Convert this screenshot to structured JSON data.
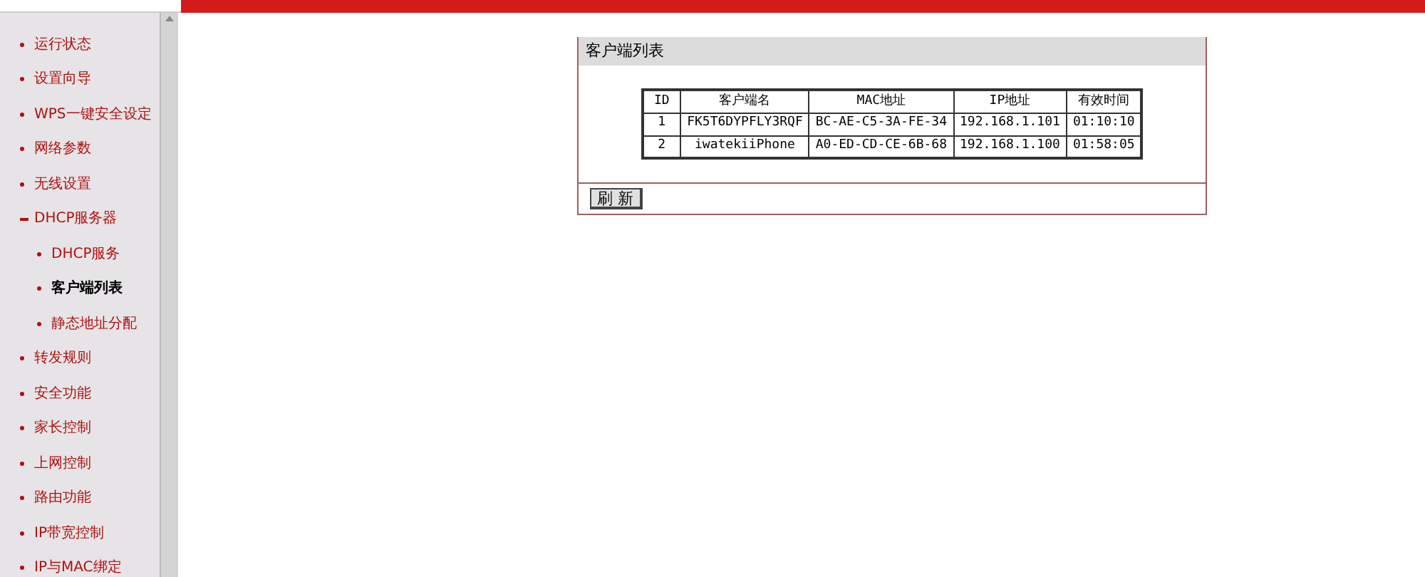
{
  "sidebar": {
    "items": [
      {
        "label": "运行状态",
        "expanded": false,
        "selected": false
      },
      {
        "label": "设置向导",
        "expanded": false,
        "selected": false
      },
      {
        "label": "WPS一键安全设定",
        "expanded": false,
        "selected": false
      },
      {
        "label": "网络参数",
        "expanded": false,
        "selected": false
      },
      {
        "label": "无线设置",
        "expanded": false,
        "selected": false
      },
      {
        "label": "DHCP服务器",
        "expanded": true,
        "selected": false,
        "children": [
          {
            "label": "DHCP服务",
            "selected": false
          },
          {
            "label": "客户端列表",
            "selected": true
          },
          {
            "label": "静态地址分配",
            "selected": false
          }
        ]
      },
      {
        "label": "转发规则",
        "expanded": false,
        "selected": false
      },
      {
        "label": "安全功能",
        "expanded": false,
        "selected": false
      },
      {
        "label": "家长控制",
        "expanded": false,
        "selected": false
      },
      {
        "label": "上网控制",
        "expanded": false,
        "selected": false
      },
      {
        "label": "路由功能",
        "expanded": false,
        "selected": false
      },
      {
        "label": "IP带宽控制",
        "expanded": false,
        "selected": false
      },
      {
        "label": "IP与MAC绑定",
        "expanded": false,
        "selected": false
      }
    ]
  },
  "panel": {
    "title": "客户端列表",
    "table": {
      "columns": [
        "ID",
        "客户端名",
        "MAC地址",
        "IP地址",
        "有效时间"
      ],
      "rows": [
        [
          "1",
          "FK5T6DYPFLY3RQF",
          "BC-AE-C5-3A-FE-34",
          "192.168.1.101",
          "01:10:10"
        ],
        [
          "2",
          "iwatekiiPhone",
          "A0-ED-CD-CE-6B-68",
          "192.168.1.100",
          "01:58:05"
        ]
      ]
    },
    "button": "刷 新"
  }
}
